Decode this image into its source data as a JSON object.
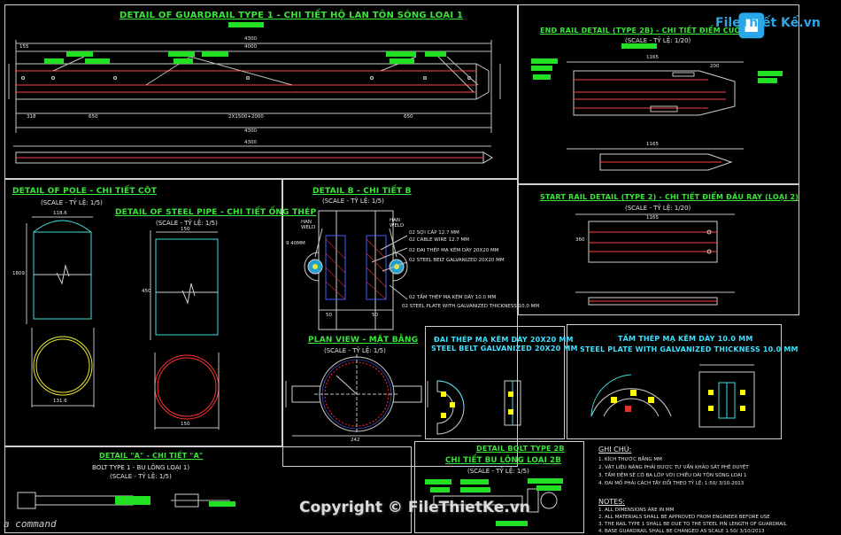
{
  "titles": {
    "guardrail": "DETAIL OF GUARDRAIL TYPE 1 - CHI TIẾT HỘ LAN TÔN SÓNG LOẠI 1",
    "end_rail": "END RAIL DETAIL (TYPE 2B) - CHI TIẾT ĐIỂM CUỐI",
    "end_rail_scale": "(SCALE - TỶ LỆ: 1/20)",
    "start_rail": "START RAIL DETAIL (TYPE 2) - CHI TIẾT ĐIỂM ĐẦU RAY (LOẠI 2)",
    "start_rail_scale": "(SCALE - TỶ LỆ: 1/20)",
    "pole": "DETAIL OF POLE - CHI TIẾT CỘT",
    "pole_scale": "(SCALE - TỶ LỆ: 1/5)",
    "steel_pipe": "DETAIL OF STEEL PIPE - CHI TIẾT ỐNG THÉP",
    "steel_pipe_scale": "(SCALE - TỶ LỆ: 1/5)",
    "detail_b": "DETAIL B - CHI TIẾT B",
    "detail_b_scale": "(SCALE - TỶ LỆ: 1/5)",
    "plan_view": "PLAN VIEW - MẶT BẰNG",
    "plan_view_scale": "(SCALE - TỶ LỆ: 1/5)",
    "belt_vn": "ĐAI THÉP MẠ KẼM DÀY 20X20 MM",
    "belt_en": "STEEL BELT GALVANIZED 20X20 MM",
    "plate_vn": "TẤM THÉP MẠ KẼM DÀY 10.0 MM",
    "plate_en": "STEEL PLATE WITH GALVANIZED THICKNESS 10.0 MM",
    "detail_a": "DETAIL \"A\" - CHI TIẾT \"A\"",
    "bolt_type1": "BOLT TYPE 1 - BU LÔNG LOẠI 1)",
    "detail_a_scale": "(SCALE - TỶ LỆ: 1/5)",
    "bolt_2b_en": "DETAIL BOLT TYPE 2B",
    "bolt_2b_vn": "CHI TIẾT BU LÔNG LOẠI 2B",
    "bolt_2b_scale": "(SCALE - TỶ LỆ: 1/5)"
  },
  "detail_b_labels": {
    "han_weld_left": "HAN WELD",
    "han_weld_right": "HAN WELD",
    "cap": "02 SỢI CÁP 12.7 MM",
    "cable": "02 CABLE WIRE 12.7 MM",
    "belt_vn": "02 ĐAI THÉP MẠ KẼM DÀY 20X20 MM",
    "belt_en": "02 STEEL BELT GALVANIZED 20X20 MM",
    "plate_vn": "02 TẤM THÉP MẠ KẼM DÀY 10.0 MM",
    "plate_en": "02 STEEL PLATE WITH GALVANIZED THICKNESS 10.0 MM",
    "dim_left": "9 40MM",
    "dim_50a": "50",
    "dim_50b": "50"
  },
  "dims": {
    "g_top": "4300",
    "g_left": "155",
    "g_sub": "4000",
    "g_bottom": "4300",
    "g_318": "318",
    "g_650a": "650",
    "g_middle": "2X1500+2000",
    "g_650b": "650",
    "g_mid2": "4300",
    "end_1165": "1165",
    "end_200": "200",
    "end_1165b": "1165",
    "pole_118": "118.6",
    "pole_1809": "1809",
    "pole_1316": "131.6",
    "pipe_150": "150",
    "pipe_450": "450",
    "pipe_150b": "150",
    "plan_242": "242",
    "start_1165": "1165",
    "start_360": "360"
  },
  "notes": {
    "ghichu_title": "GHI CHÚ:",
    "ghichu": [
      "1. KÍCH THƯỚC BẰNG MM",
      "2. VẬT LIỆU NẶNG PHẢI ĐƯỢC TƯ VẤN KHẢO SÁT PHÊ DUYỆT",
      "3. TẤM ĐỆM SẼ CÓ BA LỚP VỚI CHIỀU DÀI TÔN SÓNG LOẠI 1",
      "4. ĐAI MỐ PHẢI CÁCH TÂY ĐỔI THEO TỶ LỆ: 1:50/ 3/10-2013"
    ],
    "notes_title": "NOTES:",
    "notes": [
      "1. ALL DIMENSIONS ARE IN MM",
      "2. ALL MATERIALS SHALL BE APPROVED FROM ENGINEER BEFORE USE",
      "3. THE RAIL TYPE 1 SHALL BE DUE TO THE STEEL PIN LENGTH OF GUARDRAIL",
      "4. BASE GUARDRAIL SHALL BE CHANGED AS SCALE 1:50/ 3/10/2013"
    ]
  },
  "watermark": "Copyright © FileThietKe.vn",
  "logo_text": "FileThiết Kế.vn",
  "command_prompt": "a command",
  "colors": {
    "background": "#000000",
    "title": "#39e639",
    "label_fill": "#24e024",
    "rail_line": "#ff4040",
    "pole": "#40e0e0",
    "ring_yellow": "#e8e830",
    "ring_red": "#ff3030",
    "hatch_blue": "#4060ff",
    "highlight": "#ffff00"
  }
}
